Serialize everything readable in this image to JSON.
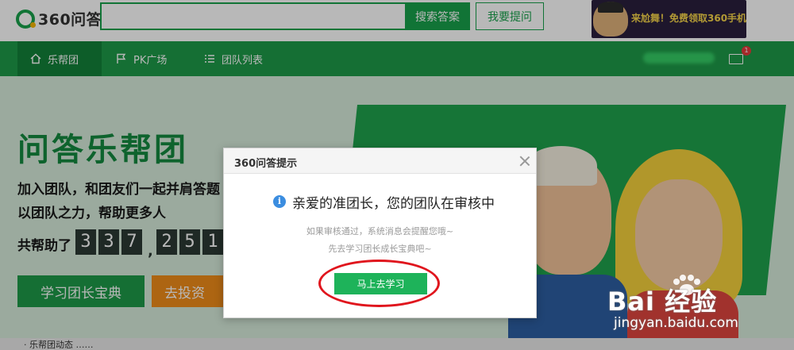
{
  "header": {
    "logo_text": "360问答",
    "search_placeholder": "",
    "search_button": "搜索答案",
    "ask_button": "我要提问",
    "ad_text": "来尬舞！免费领取360手机！"
  },
  "nav": {
    "items": [
      {
        "label": "乐帮团",
        "icon": "home-icon",
        "active": true
      },
      {
        "label": "PK广场",
        "icon": "flag-icon",
        "active": false
      },
      {
        "label": "团队列表",
        "icon": "list-icon",
        "active": false
      }
    ],
    "mail_badge": "1"
  },
  "hero": {
    "title": "问答乐帮团",
    "subtitle_line1": "加入团队，和团友们一起并肩答题",
    "subtitle_line2": "以团队之力，帮助更多人",
    "counter_label": "共帮助了",
    "counter_digits": [
      "3",
      "3",
      "7",
      "2",
      "5",
      "1"
    ],
    "learn_button": "学习团长宝典",
    "invest_button": "去投资"
  },
  "modal": {
    "title": "360问答提示",
    "message": "亲爱的准团长，您的团队在审核中",
    "tip_line1": "如果审核通过，系统消息会提醒您哦~",
    "tip_line2": "先去学习团长成长宝典吧~",
    "button": "马上去学习"
  },
  "ticker": {
    "text": "· 乐帮团动态 ……"
  },
  "watermark": {
    "brand": "Bai 经验",
    "url": "jingyan.baidu.com"
  },
  "colors": {
    "brand_green": "#1e9a48",
    "modal_button": "#1eb35a",
    "highlight_red": "#e0151d",
    "invest_orange": "#f08c1a"
  }
}
